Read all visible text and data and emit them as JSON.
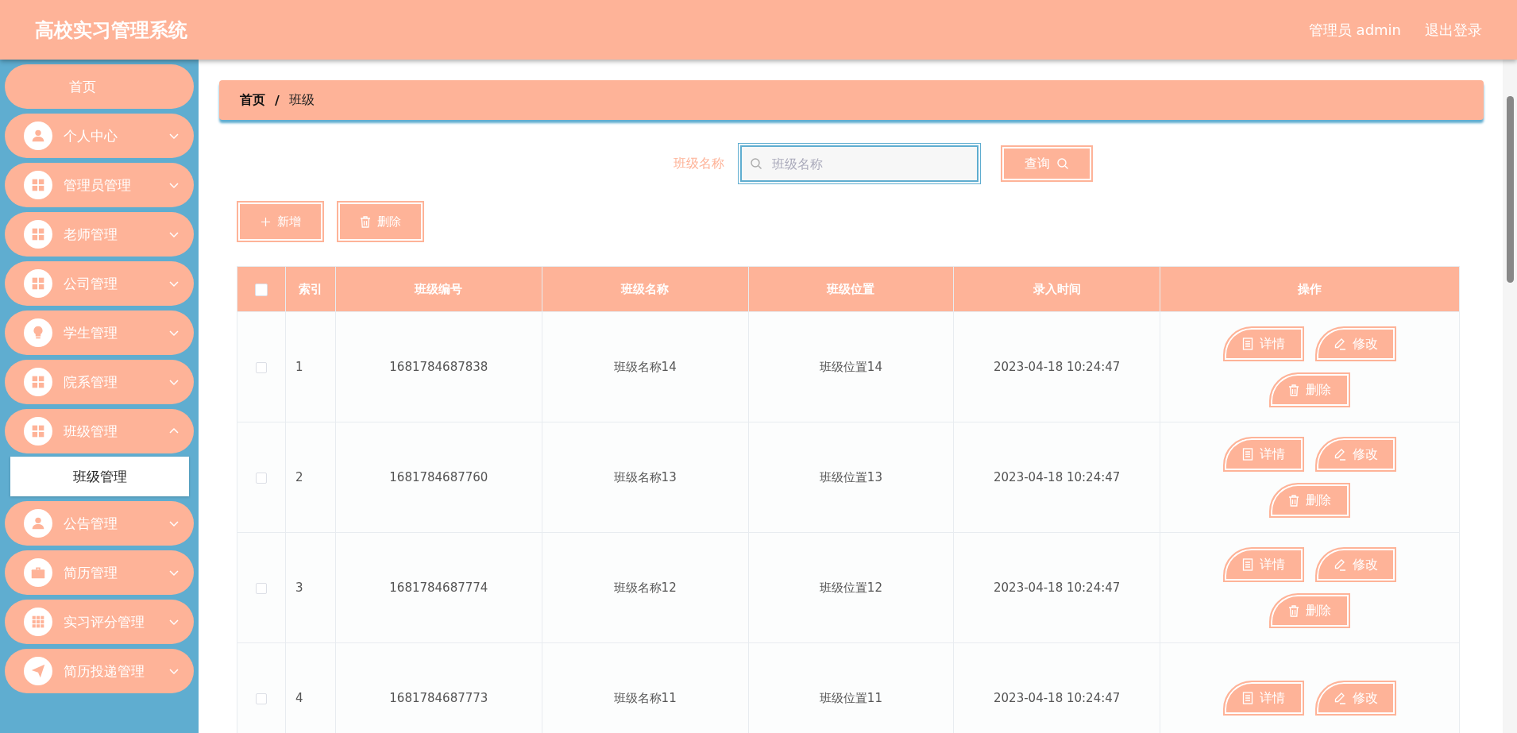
{
  "header": {
    "title": "高校实习管理系统",
    "user": "管理员 admin",
    "logout": "退出登录"
  },
  "sidebar": {
    "items": [
      {
        "kind": "link",
        "label": "首页",
        "expanded": false
      },
      {
        "kind": "menu",
        "label": "个人中心",
        "expanded": false
      },
      {
        "kind": "menu",
        "label": "管理员管理",
        "expanded": false
      },
      {
        "kind": "menu",
        "label": "老师管理",
        "expanded": false
      },
      {
        "kind": "menu",
        "label": "公司管理",
        "expanded": false
      },
      {
        "kind": "menu",
        "label": "学生管理",
        "expanded": false
      },
      {
        "kind": "menu",
        "label": "院系管理",
        "expanded": false
      },
      {
        "kind": "menu",
        "label": "班级管理",
        "expanded": true,
        "children": [
          {
            "label": "班级管理",
            "selected": true
          }
        ]
      },
      {
        "kind": "menu",
        "label": "公告管理",
        "expanded": false
      },
      {
        "kind": "menu",
        "label": "简历管理",
        "expanded": false
      },
      {
        "kind": "menu",
        "label": "实习评分管理",
        "expanded": false
      },
      {
        "kind": "menu",
        "label": "简历投递管理",
        "expanded": false
      }
    ]
  },
  "breadcrumb": {
    "items": [
      "首页",
      "班级"
    ],
    "separator": "/"
  },
  "search": {
    "label": "班级名称",
    "placeholder": "班级名称",
    "button": "查询"
  },
  "actions": [
    "新增",
    "删除"
  ],
  "table": {
    "all_checked": false,
    "columns": [
      "索引",
      "班级编号",
      "班级名称",
      "班级位置",
      "录入时间",
      "操作"
    ],
    "rows": [
      {
        "checked": false,
        "cells": [
          "1",
          "1681784687838",
          "班级名称14",
          "班级位置14",
          "2023-04-18 10:24:47"
        ],
        "actions": [
          "详情",
          "修改",
          "删除"
        ]
      },
      {
        "checked": false,
        "cells": [
          "2",
          "1681784687760",
          "班级名称13",
          "班级位置13",
          "2023-04-18 10:24:47"
        ],
        "actions": [
          "详情",
          "修改",
          "删除"
        ]
      },
      {
        "checked": false,
        "cells": [
          "3",
          "1681784687774",
          "班级名称12",
          "班级位置12",
          "2023-04-18 10:24:47"
        ],
        "actions": [
          "详情",
          "修改",
          "删除"
        ]
      },
      {
        "checked": false,
        "cells": [
          "4",
          "1681784687773",
          "班级名称11",
          "班级位置11",
          "2023-04-18 10:24:47"
        ],
        "actions": [
          "详情",
          "修改"
        ]
      }
    ]
  }
}
